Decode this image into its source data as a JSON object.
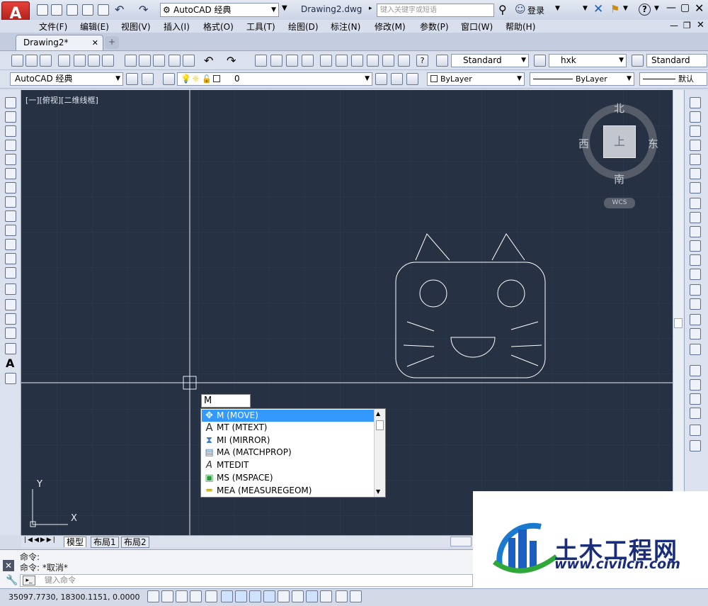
{
  "titlebar": {
    "app_letter": "A",
    "workspace": "AutoCAD 经典",
    "document_title": "Drawing2.dwg",
    "search_placeholder": "键入关键字或短语",
    "login": "登录"
  },
  "menubar": {
    "items": [
      "文件(F)",
      "编辑(E)",
      "视图(V)",
      "插入(I)",
      "格式(O)",
      "工具(T)",
      "绘图(D)",
      "标注(N)",
      "修改(M)",
      "参数(P)",
      "窗口(W)",
      "帮助(H)"
    ]
  },
  "tabs": {
    "drawing_tab": "Drawing2*",
    "add_tab": "+"
  },
  "toolbar_styles": {
    "text_style": "Standard",
    "dim_style": "hxk",
    "table_style": "Standard"
  },
  "toolbar_layers": {
    "workspace": "AutoCAD 经典",
    "layer": "0",
    "color": "ByLayer",
    "linetype": "ByLayer",
    "lineweight": "默认"
  },
  "canvas": {
    "viewport_label": "[一][俯视][二维线框]"
  },
  "viewcube": {
    "north": "北",
    "south": "南",
    "east": "东",
    "west": "西",
    "top_face": "上",
    "wcs": "WCS"
  },
  "ucs": {
    "x": "X",
    "y": "Y"
  },
  "autocomplete": {
    "typed": "M",
    "items": [
      {
        "label": "M (MOVE)",
        "icon": "move-icon",
        "glyph": "✥"
      },
      {
        "label": "MT (MTEXT)",
        "icon": "mtext-icon",
        "glyph": "A"
      },
      {
        "label": "MI (MIRROR)",
        "icon": "mirror-icon",
        "glyph": "⧗"
      },
      {
        "label": "MA (MATCHPROP)",
        "icon": "matchprop-icon",
        "glyph": "▤"
      },
      {
        "label": "MTEDIT",
        "icon": "mtedit-icon",
        "glyph": "A"
      },
      {
        "label": "MS (MSPACE)",
        "icon": "mspace-icon",
        "glyph": "▣"
      },
      {
        "label": "MEA (MEASUREGEOM)",
        "icon": "measure-icon",
        "glyph": "═"
      }
    ]
  },
  "layout_tabs": [
    "模型",
    "布局1",
    "布局2"
  ],
  "command": {
    "history": [
      "命令:",
      "命令: *取消*"
    ],
    "prompt_placeholder": "键入命令"
  },
  "status": {
    "coordinates": "35097.7730, 18300.1151, 0.0000"
  },
  "watermark": {
    "name": "土木工程网",
    "url": "www.civilcn.com"
  },
  "colors": {
    "canvas_bg": "#263143",
    "drawing_lines": "#ffffff",
    "selection": "#3399ff",
    "app_red": "#c8241c"
  }
}
